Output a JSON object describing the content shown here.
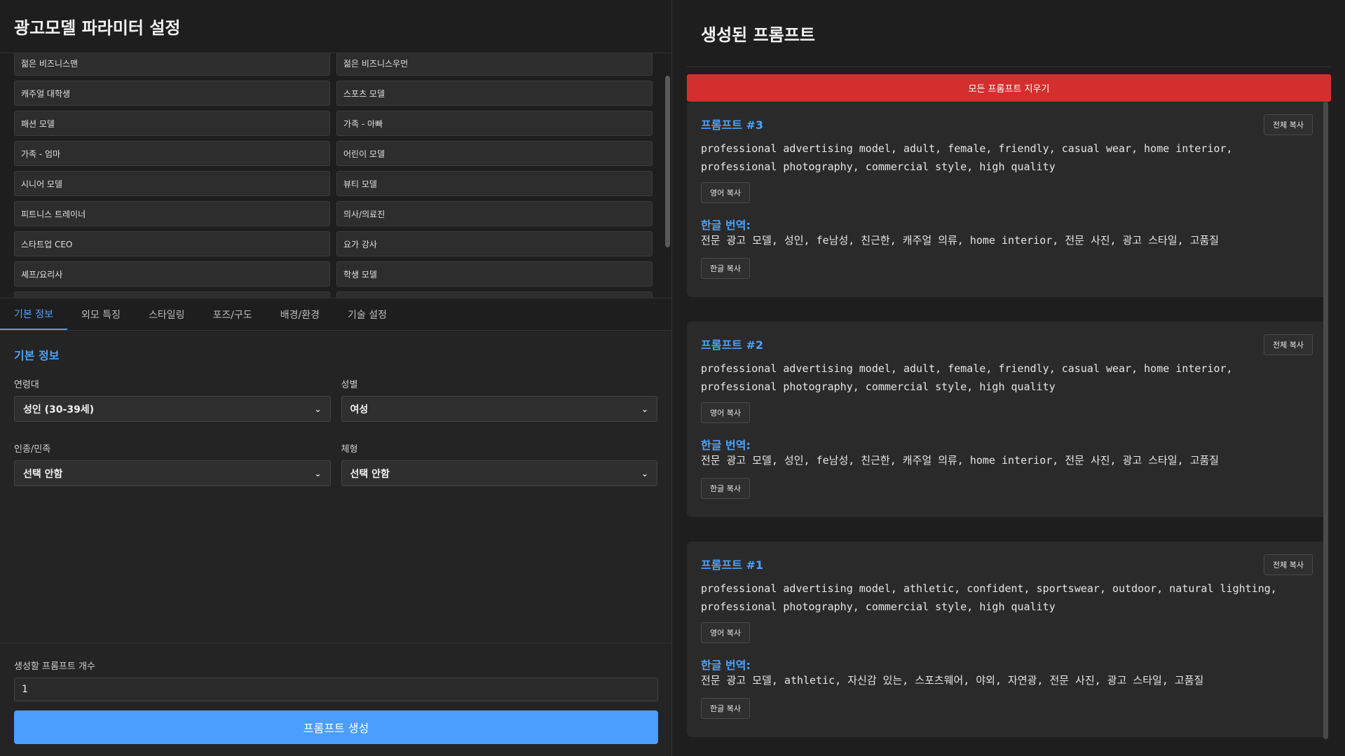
{
  "left": {
    "title": "광고모델 파라미터 설정",
    "presets": [
      "젊은 비즈니스맨",
      "젊은 비즈니스우먼",
      "캐주얼 대학생",
      "스포츠 모델",
      "패션 모델",
      "가족 - 아빠",
      "가족 - 엄마",
      "어린이 모델",
      "시니어 모델",
      "뷰티 모델",
      "피트니스 트레이너",
      "의사/의료진",
      "스타트업 CEO",
      "요가 강사",
      "셰프/요리사",
      "학생 모델"
    ],
    "tabs": [
      "기본 정보",
      "외모 특징",
      "스타일링",
      "포즈/구도",
      "배경/환경",
      "기술 설정"
    ],
    "section_title": "기본 정보",
    "fields": {
      "age_label": "연령대",
      "age_value": "성인 (30-39세)",
      "gender_label": "성별",
      "gender_value": "여성",
      "ethnicity_label": "인종/민족",
      "ethnicity_value": "선택 안함",
      "body_label": "체형",
      "body_value": "선택 안함"
    },
    "count_label": "생성할 프롬프트 개수",
    "count_value": "1",
    "generate_label": "프롬프트 생성"
  },
  "right": {
    "title": "생성된 프롬프트",
    "clear_label": "모든 프롬프트 지우기",
    "copy_all_label": "전체 복사",
    "copy_en_label": "영어 복사",
    "copy_ko_label": "한글 복사",
    "ko_label": "한글 번역:",
    "prompts": [
      {
        "title": "프롬프트 #3",
        "en": "professional advertising model, adult, female, friendly, casual wear, home interior, professional photography, commercial style, high quality",
        "ko": "전문 광고 모델, 성인, fe남성, 친근한, 캐주얼 의류, home interior, 전문 사진, 광고 스타일, 고품질"
      },
      {
        "title": "프롬프트 #2",
        "en": "professional advertising model, adult, female, friendly, casual wear, home interior, professional photography, commercial style, high quality",
        "ko": "전문 광고 모델, 성인, fe남성, 친근한, 캐주얼 의류, home interior, 전문 사진, 광고 스타일, 고품질"
      },
      {
        "title": "프롬프트 #1",
        "en": "professional advertising model, athletic, confident, sportswear, outdoor, natural lighting, professional photography, commercial style, high quality",
        "ko": "전문 광고 모델, athletic, 자신감 있는, 스포츠웨어, 야외, 자연광, 전문 사진, 광고 스타일, 고품질"
      }
    ]
  }
}
